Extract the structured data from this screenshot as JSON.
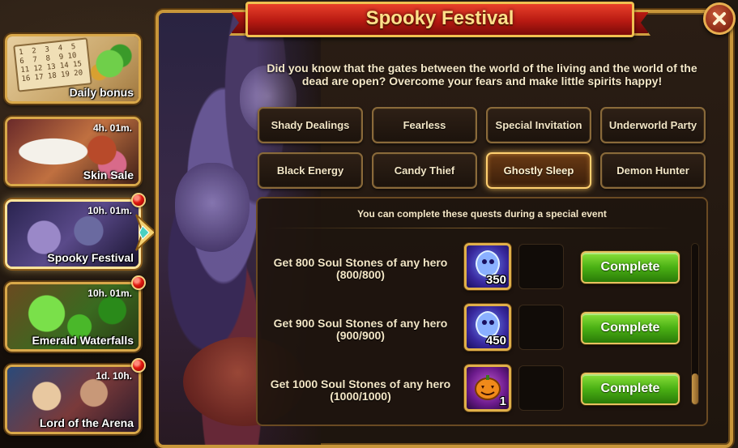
{
  "sidebar": {
    "events": [
      {
        "label": "Daily bonus",
        "timer": "",
        "badge": false
      },
      {
        "label": "Skin Sale",
        "timer": "4h. 01m.",
        "badge": false
      },
      {
        "label": "Spooky Festival",
        "timer": "10h. 01m.",
        "badge": true,
        "active": true
      },
      {
        "label": "Emerald Waterfalls",
        "timer": "10h. 01m.",
        "badge": true
      },
      {
        "label": "Lord of the Arena",
        "timer": "1d. 10h.",
        "badge": true
      }
    ],
    "calendar_text": "1  2  3  4  5\n6  7  8  9 10\n11 12 13 14 15\n16 17 18 19 20"
  },
  "header": {
    "title": "Spooky Festival",
    "close_icon": "close-x-icon"
  },
  "intro_text": "Did you know that the gates between the world of the living and the world of the dead are open? Overcome your fears and make little spirits happy!",
  "tabs": [
    {
      "label": "Shady Dealings",
      "active": false
    },
    {
      "label": "Fearless",
      "active": false
    },
    {
      "label": "Special Invitation",
      "active": false
    },
    {
      "label": "Underworld Party",
      "active": false
    },
    {
      "label": "Black Energy",
      "active": false
    },
    {
      "label": "Candy Thief",
      "active": false
    },
    {
      "label": "Ghostly Sleep",
      "active": true
    },
    {
      "label": "Demon Hunter",
      "active": false
    }
  ],
  "quests": {
    "subtitle": "You can complete these quests during a special event",
    "items": [
      {
        "line1": "Get 800 Soul Stones of any hero",
        "line2": "(800/800)",
        "reward_icon": "soul-stone-icon",
        "reward_qty": "350",
        "action": "Complete"
      },
      {
        "line1": "Get 900 Soul Stones of any hero",
        "line2": "(900/900)",
        "reward_icon": "soul-stone-icon",
        "reward_qty": "450",
        "action": "Complete"
      },
      {
        "line1": "Get 1000 Soul Stones of any hero",
        "line2": "(1000/1000)",
        "reward_icon": "pumpkin-icon",
        "reward_qty": "1",
        "action": "Complete"
      }
    ]
  },
  "colors": {
    "frame_gold": "#c8963a",
    "banner_red": "#b81a12",
    "complete_green": "#4ab014",
    "active_tab_glow": "#ffd070",
    "notification_red": "#e01a10"
  }
}
